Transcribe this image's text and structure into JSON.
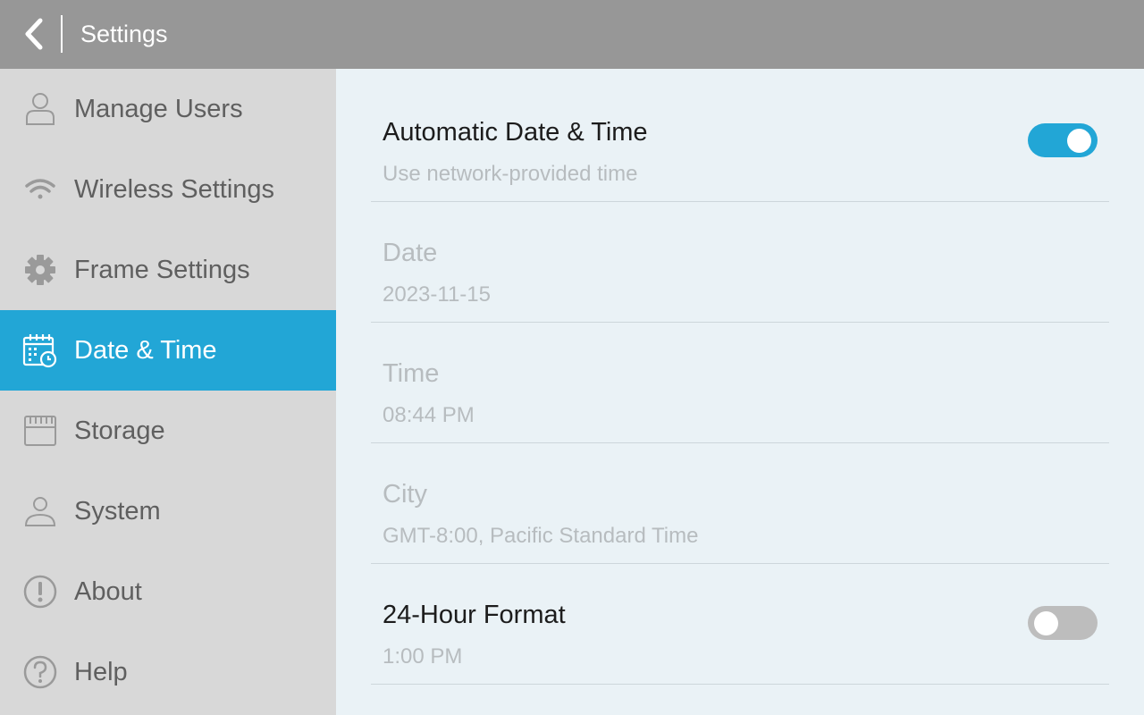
{
  "header": {
    "title": "Settings"
  },
  "sidebar": {
    "items": [
      {
        "label": "Manage Users",
        "icon": "user-icon"
      },
      {
        "label": "Wireless Settings",
        "icon": "wifi-icon"
      },
      {
        "label": "Frame Settings",
        "icon": "gear-icon"
      },
      {
        "label": "Date & Time",
        "icon": "calendar-clock-icon",
        "active": true
      },
      {
        "label": "Storage",
        "icon": "sd-card-icon"
      },
      {
        "label": "System",
        "icon": "person-icon"
      },
      {
        "label": "About",
        "icon": "info-icon"
      },
      {
        "label": "Help",
        "icon": "help-icon"
      }
    ]
  },
  "settings": {
    "auto_datetime": {
      "title": "Automatic Date & Time",
      "subtitle": "Use network-provided time",
      "enabled": true
    },
    "date": {
      "title": "Date",
      "value": "2023-11-15"
    },
    "time": {
      "title": "Time",
      "value": "08:44 PM"
    },
    "city": {
      "title": "City",
      "value": "GMT-8:00, Pacific Standard Time"
    },
    "hour24": {
      "title": "24-Hour Format",
      "subtitle": "1:00 PM",
      "enabled": false
    }
  },
  "colors": {
    "accent": "#22a6d6",
    "header": "#979797",
    "sidebar": "#d8d8d8",
    "content": "#eaf2f6"
  }
}
